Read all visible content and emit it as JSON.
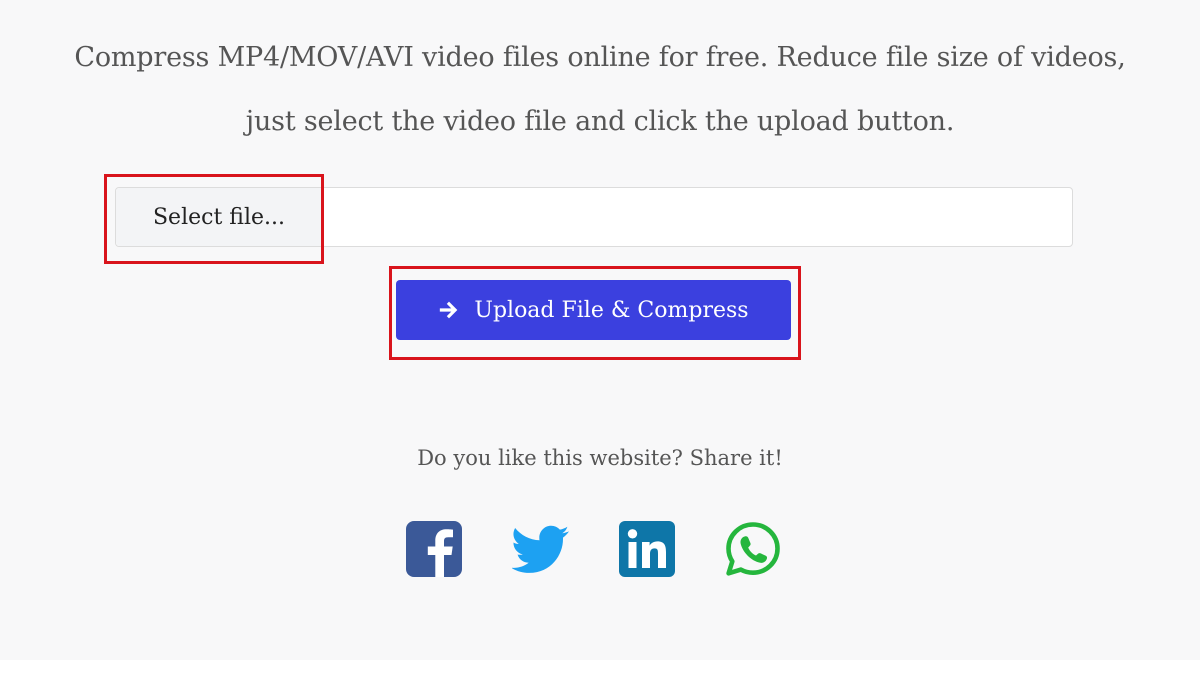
{
  "intro": {
    "line1": "Compress MP4/MOV/AVI video files online for free. Reduce file size of videos,",
    "line2": "just select the video file and click the upload button."
  },
  "file_picker": {
    "button_label": "Select file...",
    "file_name_value": ""
  },
  "upload": {
    "button_label": "Upload File & Compress",
    "icon": "arrow-right-icon"
  },
  "share": {
    "prompt": "Do you like this website? Share it!",
    "icons": [
      "facebook-icon",
      "twitter-icon",
      "linkedin-icon",
      "whatsapp-icon"
    ]
  },
  "colors": {
    "upload_button": "#3b40df",
    "highlight_border": "#d9141c",
    "facebook": "#3b5998",
    "twitter": "#1da1f2",
    "linkedin": "#0e76a8",
    "whatsapp": "#25b63d"
  }
}
